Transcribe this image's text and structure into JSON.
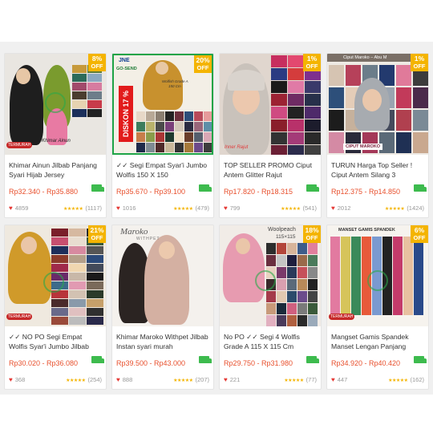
{
  "products": [
    {
      "title": "Khimar Ainun Jilbab Panjang Syari Hijab Jersey",
      "price": "Rp32.340 - Rp35.880",
      "discount": "8%",
      "off_label": "OFF",
      "likes": "4859",
      "reviews": "(1117)",
      "image_text": [
        "Khimar Ainun",
        "TERMURAH"
      ]
    },
    {
      "title": "✓✓ Segi Empat Syar'i Jumbo Wolfis 150 X 150",
      "price": "Rp35.670 - Rp39.100",
      "discount": "20%",
      "off_label": "OFF",
      "likes": "1016",
      "reviews": "(479)",
      "image_text": [
        "JNE",
        "GO-SEND",
        "Wolfish Grade A",
        "150 Cm",
        "DISKON 17 %"
      ]
    },
    {
      "title": "TOP SELLER PROMO Ciput Antem Glitter Rajut",
      "price": "Rp17.820 - Rp18.315",
      "discount": "1%",
      "off_label": "OFF",
      "likes": "799",
      "reviews": "(541)",
      "image_text": [
        "Inner Rajut"
      ]
    },
    {
      "title": "TURUN Harga Top Seller ! Ciput Antem Silang 3",
      "price": "Rp12.375 - Rp14.850",
      "discount": "1%",
      "off_label": "OFF",
      "likes": "2012",
      "reviews": "(1424)",
      "image_text": [
        "Ciput Maroko – Abu M",
        "CIPUT MAROKO"
      ]
    },
    {
      "title": "✓✓ NO PO Segi Empat Wolfis Syar'i Jumbo Jilbab",
      "price": "Rp30.020 - Rp36.080",
      "discount": "21%",
      "off_label": "OFF",
      "likes": "368",
      "reviews": "(254)",
      "image_text": [
        "TERMURAH"
      ]
    },
    {
      "title": "Khimar Maroko Withpet Jilbab Instan syari murah",
      "price": "Rp39.500 - Rp43.000",
      "discount": "",
      "off_label": "",
      "likes": "888",
      "reviews": "(207)",
      "image_text": [
        "Maroko",
        "WITHPET"
      ]
    },
    {
      "title": "No PO ✓✓ Segi 4 Wolfis Grade A 115 X 115 Cm",
      "price": "Rp29.750 - Rp31.980",
      "discount": "18%",
      "off_label": "OFF",
      "likes": "221",
      "reviews": "(77)",
      "image_text": [
        "Woolpeach",
        "115×115"
      ]
    },
    {
      "title": "Mangset Gamis Spandek Manset Lengan Panjang",
      "price": "Rp34.920 - Rp40.420",
      "discount": "6%",
      "off_label": "OFF",
      "likes": "447",
      "reviews": "(162)",
      "image_text": [
        "MANSET GAMIS SPANDEK",
        "TERMURAH"
      ]
    }
  ],
  "colors": {
    "price": "#e8502d",
    "badge": "#f4b400",
    "star": "#f4b400",
    "heart": "#e53935",
    "ship": "#3dbb4e"
  }
}
